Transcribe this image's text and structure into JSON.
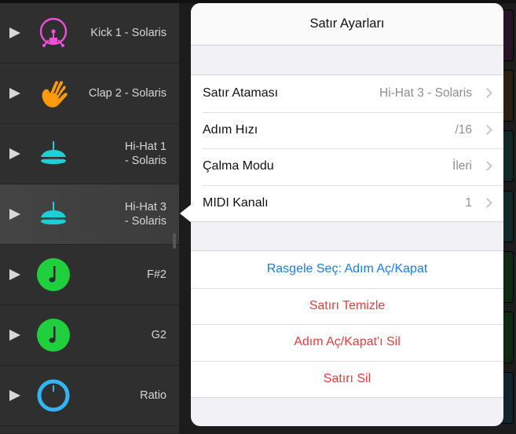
{
  "tracks": [
    {
      "name": "Kick 1 - Solaris",
      "icon": "kick-drum-icon",
      "color": "#f050d8",
      "selected": false
    },
    {
      "name": "Clap 2 - Solaris",
      "icon": "hand-clap-icon",
      "color": "#ff9a0a",
      "selected": false
    },
    {
      "name": "Hi-Hat 1\n- Solaris",
      "icon": "hi-hat-icon",
      "color": "#1fcfd6",
      "selected": false
    },
    {
      "name": "Hi-Hat 3\n- Solaris",
      "icon": "hi-hat-icon",
      "color": "#1fcfd6",
      "selected": true
    },
    {
      "name": "F#2",
      "icon": "music-note-icon",
      "color": "#1ed03c",
      "selected": false
    },
    {
      "name": "G2",
      "icon": "music-note-icon",
      "color": "#1ed03c",
      "selected": false
    },
    {
      "name": "Ratio",
      "icon": "knob-icon",
      "color": "#33b5f5",
      "selected": false
    }
  ],
  "pad_colors": [
    "#2a1428",
    "#2a2010",
    "#0f2a28",
    "#0f2a28",
    "#0f2a12",
    "#0f2a12",
    "#10252c"
  ],
  "accent_colors": {
    "pink": "#e040c8",
    "green": "#22c840"
  },
  "popover": {
    "title": "Satır Ayarları",
    "settings": [
      {
        "label": "Satır Ataması",
        "value": "Hi-Hat 3 - Solaris"
      },
      {
        "label": "Adım Hızı",
        "value": "/16"
      },
      {
        "label": "Çalma Modu",
        "value": "İleri"
      },
      {
        "label": "MIDI Kanalı",
        "value": "1"
      }
    ],
    "actions": [
      {
        "label": "Rasgele Seç: Adım Aç/Kapat",
        "color": "#1a7ee6"
      },
      {
        "label": "Satırı Temizle",
        "color": "#f03a3a"
      },
      {
        "label": "Adım Aç/Kapat'ı Sil",
        "color": "#f03a3a"
      },
      {
        "label": "Satırı Sil",
        "color": "#f03a3a"
      }
    ]
  }
}
